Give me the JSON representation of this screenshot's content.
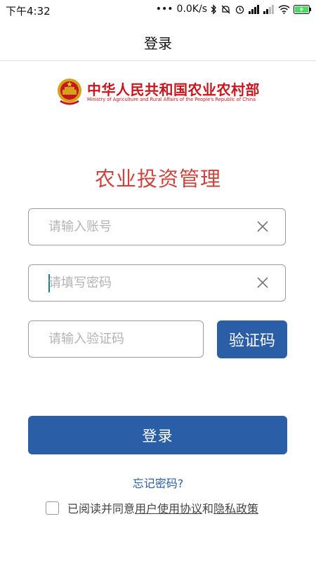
{
  "status_bar": {
    "time": "下午4:32",
    "network_speed": "0.0K/s",
    "battery_color": "#4cd964"
  },
  "nav": {
    "title": "登录"
  },
  "logo": {
    "org_name_cn": "中华人民共和国农业农村部",
    "org_name_en": "Ministry of Agriculture and Rural Affairs of the People's Republic of China",
    "emblem_icon": "national-emblem-icon"
  },
  "app_title": "农业投资管理",
  "form": {
    "account_placeholder": "请输入账号",
    "account_value": "",
    "password_placeholder": "请填写密码",
    "password_value": "",
    "captcha_placeholder": "请输入验证码",
    "captcha_value": "",
    "captcha_button": "验证码",
    "login_button": "登录",
    "forgot_password": "忘记密码?"
  },
  "agreement": {
    "checked": false,
    "prefix": "已阅读并同意",
    "user_agreement": "用户使用协议",
    "and": "和",
    "privacy_policy": "隐私政策"
  },
  "colors": {
    "primary": "#2a5ea7",
    "title_red": "#c9463e",
    "logo_red": "#c8161d"
  }
}
